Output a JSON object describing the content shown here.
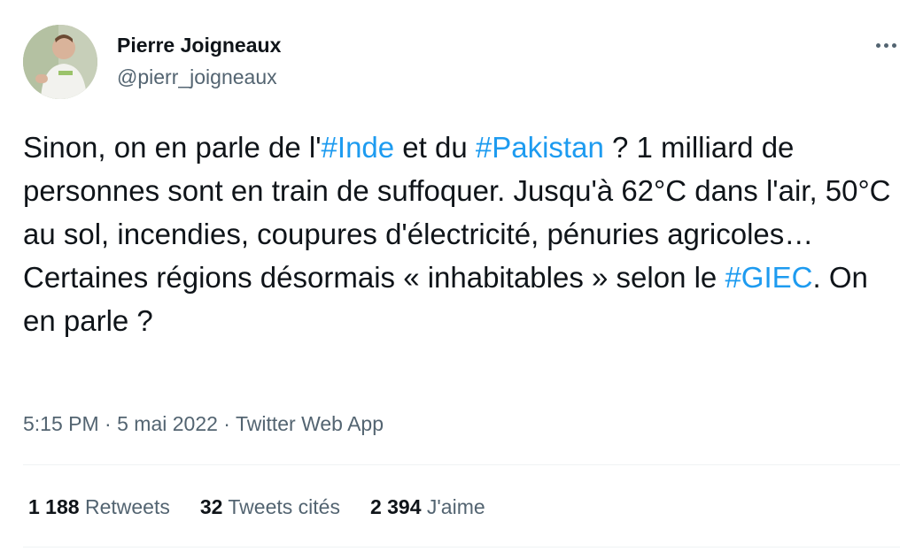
{
  "author": {
    "name": "Pierre Joigneaux",
    "handle": "@pierr_joigneaux"
  },
  "tweet": {
    "segments": [
      {
        "text": "Sinon, on en parle de l'",
        "hashtag": false
      },
      {
        "text": "#Inde",
        "hashtag": true
      },
      {
        "text": " et du ",
        "hashtag": false
      },
      {
        "text": "#Pakistan",
        "hashtag": true
      },
      {
        "text": " ? 1 milliard de personnes sont en train de suffoquer. Jusqu'à 62°C dans l'air, 50°C au sol, incendies, coupures d'électricité, pénuries agricoles… Certaines régions désormais « inhabitables » selon le ",
        "hashtag": false
      },
      {
        "text": "#GIEC",
        "hashtag": true
      },
      {
        "text": ". On en parle ?",
        "hashtag": false
      }
    ]
  },
  "meta": {
    "time": "5:15 PM",
    "separator": " · ",
    "date": "5 mai 2022",
    "source": "Twitter Web App"
  },
  "stats": {
    "retweets_count": "1 188",
    "retweets_label": "Retweets",
    "quotes_count": "32",
    "quotes_label": "Tweets cités",
    "likes_count": "2 394",
    "likes_label": "J'aime"
  },
  "icons": {
    "more": "more-horizontal-icon",
    "avatar": "profile-avatar"
  },
  "colors": {
    "hashtag": "#1d9bf0",
    "secondary_text": "#536471",
    "primary_text": "#0f1419",
    "divider": "#eff3f4"
  }
}
